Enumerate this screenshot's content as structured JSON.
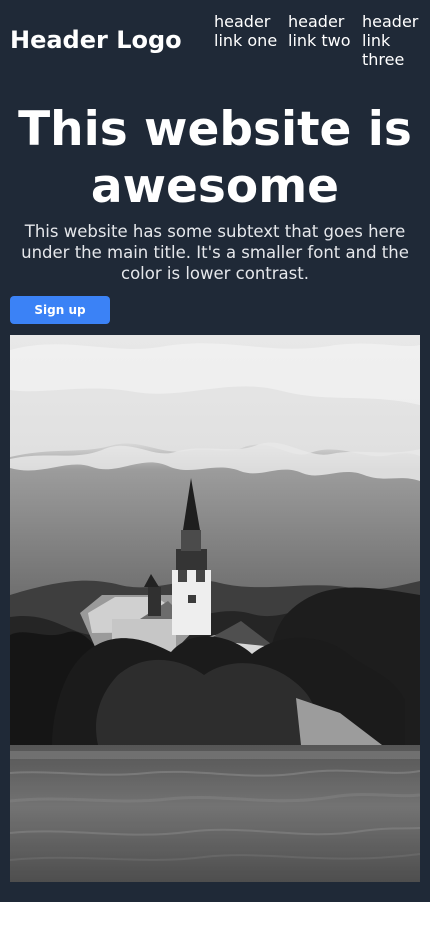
{
  "header": {
    "logo": "Header Logo",
    "links": [
      {
        "label": "header link one"
      },
      {
        "label": "header link two"
      },
      {
        "label": "header link three"
      }
    ]
  },
  "hero": {
    "title": "This website is awesome",
    "subtext": "This website has some subtext that goes here under the main title. It's a smaller font and the color is lower contrast.",
    "button_label": "Sign up"
  },
  "image": {
    "subject": "black-and-white lake island church photo"
  },
  "colors": {
    "background": "#1f2937",
    "button": "#3b82f6",
    "text": "#ffffff",
    "page": "#ffffff"
  }
}
